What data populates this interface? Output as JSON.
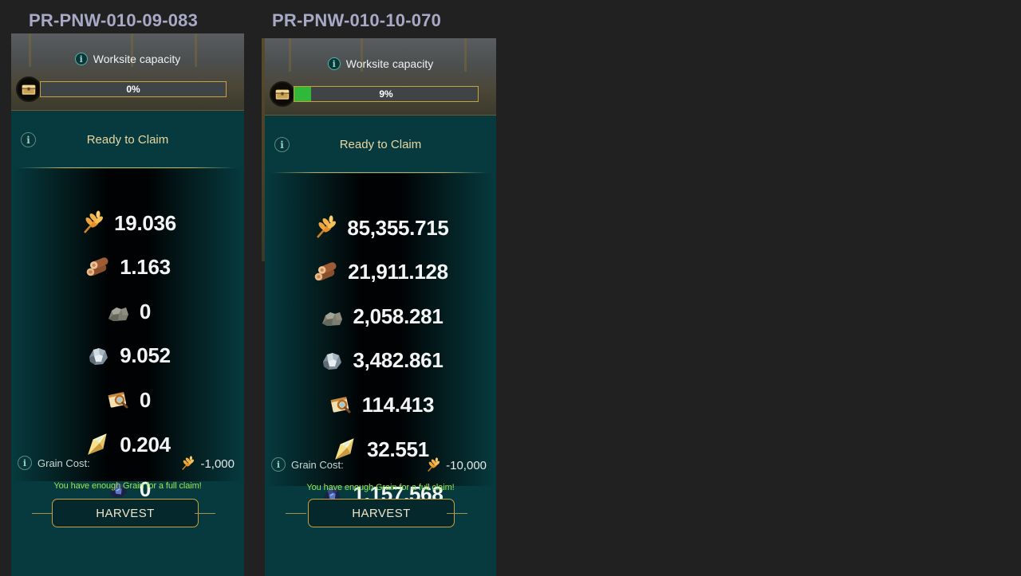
{
  "panels": [
    {
      "title": "PR-PNW-010-09-083",
      "capacity_label": "Worksite capacity",
      "progress_text": "0%",
      "progress_fraction": 0.0,
      "claim_label": "Ready to Claim",
      "resources": [
        {
          "icon": "grain-icon",
          "value": "19.036"
        },
        {
          "icon": "wood-icon",
          "value": "1.163"
        },
        {
          "icon": "stone-icon",
          "value": "0"
        },
        {
          "icon": "iron-ore-icon",
          "value": "9.052"
        },
        {
          "icon": "map-scroll-icon",
          "value": "0"
        },
        {
          "icon": "crystal-icon",
          "value": "0.204"
        },
        {
          "icon": "dark-ore-icon",
          "value": "0"
        }
      ],
      "cost_label": "Grain Cost:",
      "cost_value": "-1,000",
      "enough_message": "You have enough Grain for a full claim!",
      "harvest_label": "HARVEST"
    },
    {
      "title": "PR-PNW-010-10-070",
      "capacity_label": "Worksite capacity",
      "progress_text": "9%",
      "progress_fraction": 0.09,
      "claim_label": "Ready to Claim",
      "resources": [
        {
          "icon": "grain-icon",
          "value": "85,355.715"
        },
        {
          "icon": "wood-icon",
          "value": "21,911.128"
        },
        {
          "icon": "stone-icon",
          "value": "2,058.281"
        },
        {
          "icon": "iron-ore-icon",
          "value": "3,482.861"
        },
        {
          "icon": "map-scroll-icon",
          "value": "114.413"
        },
        {
          "icon": "crystal-icon",
          "value": "32.551"
        },
        {
          "icon": "dark-ore-icon",
          "value": "1,157.568"
        }
      ],
      "cost_label": "Grain Cost:",
      "cost_value": "-10,000",
      "enough_message": "You have enough Grain for a full claim!",
      "harvest_label": "HARVEST"
    }
  ],
  "colors": {
    "background": "#212121",
    "card": "#063a3e",
    "gold": "#c9a13f",
    "progress_fill": "#2fb83a",
    "message_green": "#99e84d",
    "title": "#a7a9c6"
  }
}
